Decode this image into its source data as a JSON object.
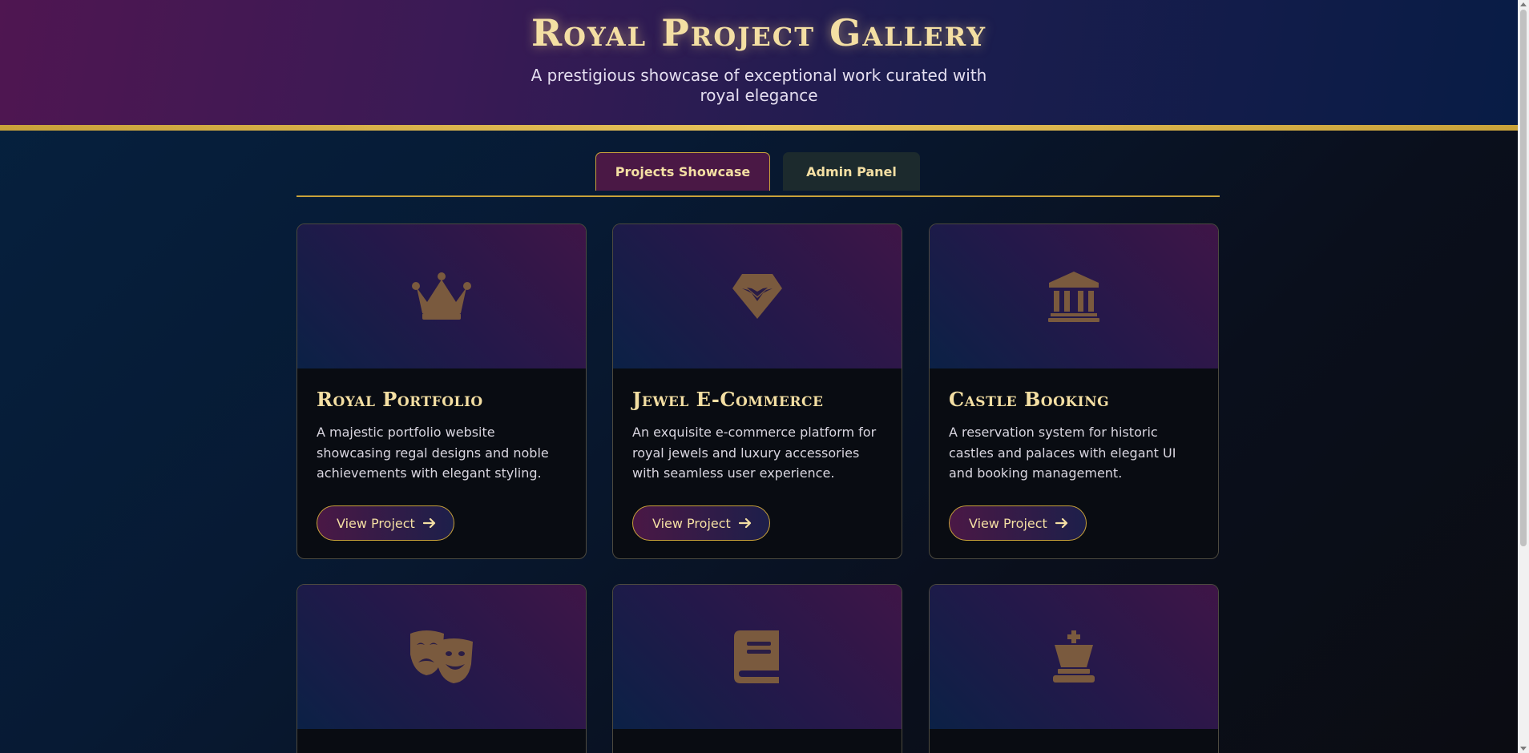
{
  "header": {
    "title": "Royal Project Gallery",
    "subtitle": "A prestigious showcase of exceptional work curated with royal elegance"
  },
  "tabs": [
    {
      "label": "Projects Showcase",
      "active": true
    },
    {
      "label": "Admin Panel",
      "active": false
    }
  ],
  "projects": [
    {
      "icon": "crown-icon",
      "title": "Royal Portfolio",
      "description": "A majestic portfolio website showcasing regal designs and noble achievements with elegant styling.",
      "button": "View Project"
    },
    {
      "icon": "gem-icon",
      "title": "Jewel E-Commerce",
      "description": "An exquisite e-commerce platform for royal jewels and luxury accessories with seamless user experience.",
      "button": "View Project"
    },
    {
      "icon": "landmark-icon",
      "title": "Castle Booking",
      "description": "A reservation system for historic castles and palaces with elegant UI and booking management.",
      "button": "View Project"
    },
    {
      "icon": "masks-theater-icon",
      "title": "",
      "description": "",
      "button": ""
    },
    {
      "icon": "book-icon",
      "title": "",
      "description": "",
      "button": ""
    },
    {
      "icon": "chess-king-icon",
      "title": "",
      "description": "",
      "button": ""
    }
  ],
  "colors": {
    "gold": "#c9a23a",
    "title_gold": "#f4dfa3",
    "icon": "#7a5a3e",
    "purple": "#4a1845",
    "navy": "#05213f"
  }
}
